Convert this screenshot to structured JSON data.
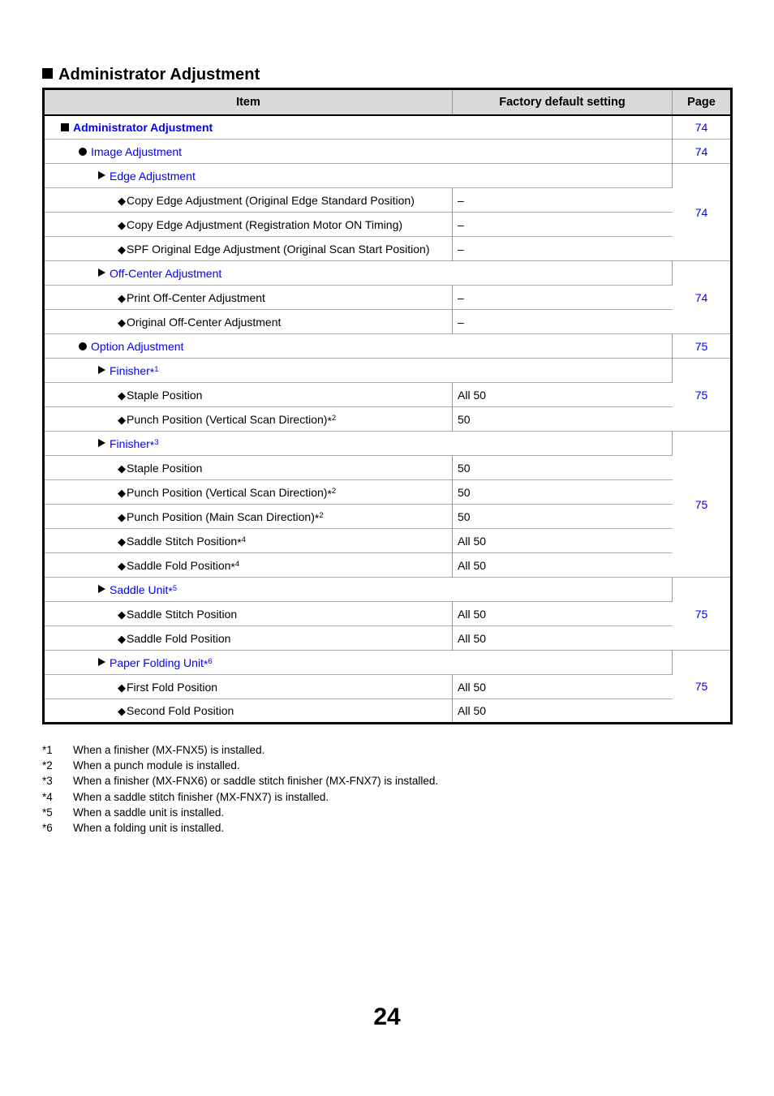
{
  "heading": {
    "marker": "square",
    "title": "Administrator Adjustment"
  },
  "table": {
    "columns": {
      "item": "Item",
      "factory": "Factory default setting",
      "page": "Page"
    },
    "rows": [
      {
        "level": 1,
        "marker": "square",
        "label": "Administrator Adjustment",
        "footnote": "",
        "factory": null,
        "page": "74",
        "page_rowspan": 1,
        "span_item": true
      },
      {
        "level": 2,
        "marker": "circle",
        "label": "Image Adjustment",
        "footnote": "",
        "factory": null,
        "page": "74",
        "page_rowspan": 1,
        "span_item": true
      },
      {
        "level": 3,
        "marker": "triangle",
        "label": "Edge Adjustment",
        "footnote": "",
        "factory": null,
        "page": "74",
        "page_rowspan": 4,
        "span_item": true
      },
      {
        "level": 4,
        "marker": "diamond",
        "label": "Copy Edge Adjustment (Original Edge Standard Position)",
        "footnote": "",
        "factory": "–",
        "page": null,
        "page_rowspan": 0,
        "span_item": false
      },
      {
        "level": 4,
        "marker": "diamond",
        "label": "Copy Edge Adjustment (Registration Motor ON Timing)",
        "footnote": "",
        "factory": "–",
        "page": null,
        "page_rowspan": 0,
        "span_item": false
      },
      {
        "level": 4,
        "marker": "diamond",
        "label": "SPF Original Edge Adjustment (Original Scan Start Position)",
        "footnote": "",
        "factory": "–",
        "page": null,
        "page_rowspan": 0,
        "span_item": false
      },
      {
        "level": 3,
        "marker": "triangle",
        "label": "Off-Center Adjustment",
        "footnote": "",
        "factory": null,
        "page": "74",
        "page_rowspan": 3,
        "span_item": true
      },
      {
        "level": 4,
        "marker": "diamond",
        "label": "Print Off-Center Adjustment",
        "footnote": "",
        "factory": "–",
        "page": null,
        "page_rowspan": 0,
        "span_item": false
      },
      {
        "level": 4,
        "marker": "diamond",
        "label": "Original Off-Center Adjustment",
        "footnote": "",
        "factory": "–",
        "page": null,
        "page_rowspan": 0,
        "span_item": false
      },
      {
        "level": 2,
        "marker": "circle",
        "label": "Option Adjustment",
        "footnote": "",
        "factory": null,
        "page": "75",
        "page_rowspan": 1,
        "span_item": true
      },
      {
        "level": 3,
        "marker": "triangle",
        "label": "Finisher",
        "footnote": "1",
        "factory": null,
        "page": "75",
        "page_rowspan": 3,
        "span_item": true
      },
      {
        "level": 4,
        "marker": "diamond",
        "label": "Staple Position",
        "footnote": "",
        "factory": "All 50",
        "page": null,
        "page_rowspan": 0,
        "span_item": false
      },
      {
        "level": 4,
        "marker": "diamond",
        "label": "Punch Position (Vertical Scan Direction)",
        "footnote": "2",
        "factory": "50",
        "page": null,
        "page_rowspan": 0,
        "span_item": false
      },
      {
        "level": 3,
        "marker": "triangle",
        "label": "Finisher",
        "footnote": "3",
        "factory": null,
        "page": "75",
        "page_rowspan": 6,
        "span_item": true
      },
      {
        "level": 4,
        "marker": "diamond",
        "label": "Staple Position",
        "footnote": "",
        "factory": "50",
        "page": null,
        "page_rowspan": 0,
        "span_item": false
      },
      {
        "level": 4,
        "marker": "diamond",
        "label": "Punch Position (Vertical Scan Direction)",
        "footnote": "2",
        "factory": "50",
        "page": null,
        "page_rowspan": 0,
        "span_item": false
      },
      {
        "level": 4,
        "marker": "diamond",
        "label": "Punch Position (Main Scan Direction)",
        "footnote": "2",
        "factory": "50",
        "page": null,
        "page_rowspan": 0,
        "span_item": false
      },
      {
        "level": 4,
        "marker": "diamond",
        "label": "Saddle Stitch Position",
        "footnote": "4",
        "factory": "All 50",
        "page": null,
        "page_rowspan": 0,
        "span_item": false
      },
      {
        "level": 4,
        "marker": "diamond",
        "label": "Saddle Fold Position",
        "footnote": "4",
        "factory": "All 50",
        "page": null,
        "page_rowspan": 0,
        "span_item": false
      },
      {
        "level": 3,
        "marker": "triangle",
        "label": "Saddle Unit",
        "footnote": "5",
        "factory": null,
        "page": "75",
        "page_rowspan": 3,
        "span_item": true
      },
      {
        "level": 4,
        "marker": "diamond",
        "label": "Saddle Stitch Position",
        "footnote": "",
        "factory": "All 50",
        "page": null,
        "page_rowspan": 0,
        "span_item": false
      },
      {
        "level": 4,
        "marker": "diamond",
        "label": "Saddle Fold Position",
        "footnote": "",
        "factory": "All 50",
        "page": null,
        "page_rowspan": 0,
        "span_item": false
      },
      {
        "level": 3,
        "marker": "triangle",
        "label": "Paper Folding Unit",
        "footnote": "6",
        "factory": null,
        "page": "75",
        "page_rowspan": 3,
        "span_item": true
      },
      {
        "level": 4,
        "marker": "diamond",
        "label": "First Fold Position",
        "footnote": "",
        "factory": "All 50",
        "page": null,
        "page_rowspan": 0,
        "span_item": false
      },
      {
        "level": 4,
        "marker": "diamond",
        "label": "Second Fold Position",
        "footnote": "",
        "factory": "All 50",
        "page": null,
        "page_rowspan": 0,
        "span_item": false
      }
    ]
  },
  "footnotes": [
    {
      "mark": "*1",
      "text": "When a finisher (MX-FNX5) is installed."
    },
    {
      "mark": "*2",
      "text": "When a punch module is installed."
    },
    {
      "mark": "*3",
      "text": "When a finisher (MX-FNX6) or saddle stitch finisher (MX-FNX7) is installed."
    },
    {
      "mark": "*4",
      "text": "When a saddle stitch finisher (MX-FNX7) is installed."
    },
    {
      "mark": "*5",
      "text": "When a saddle unit is installed."
    },
    {
      "mark": "*6",
      "text": "When a folding unit is installed."
    }
  ],
  "folio": "24",
  "colors": {
    "link": "#0000ff",
    "header_bg": "#d9d9d9",
    "border": "#000000",
    "row_divider": "#adadad"
  }
}
